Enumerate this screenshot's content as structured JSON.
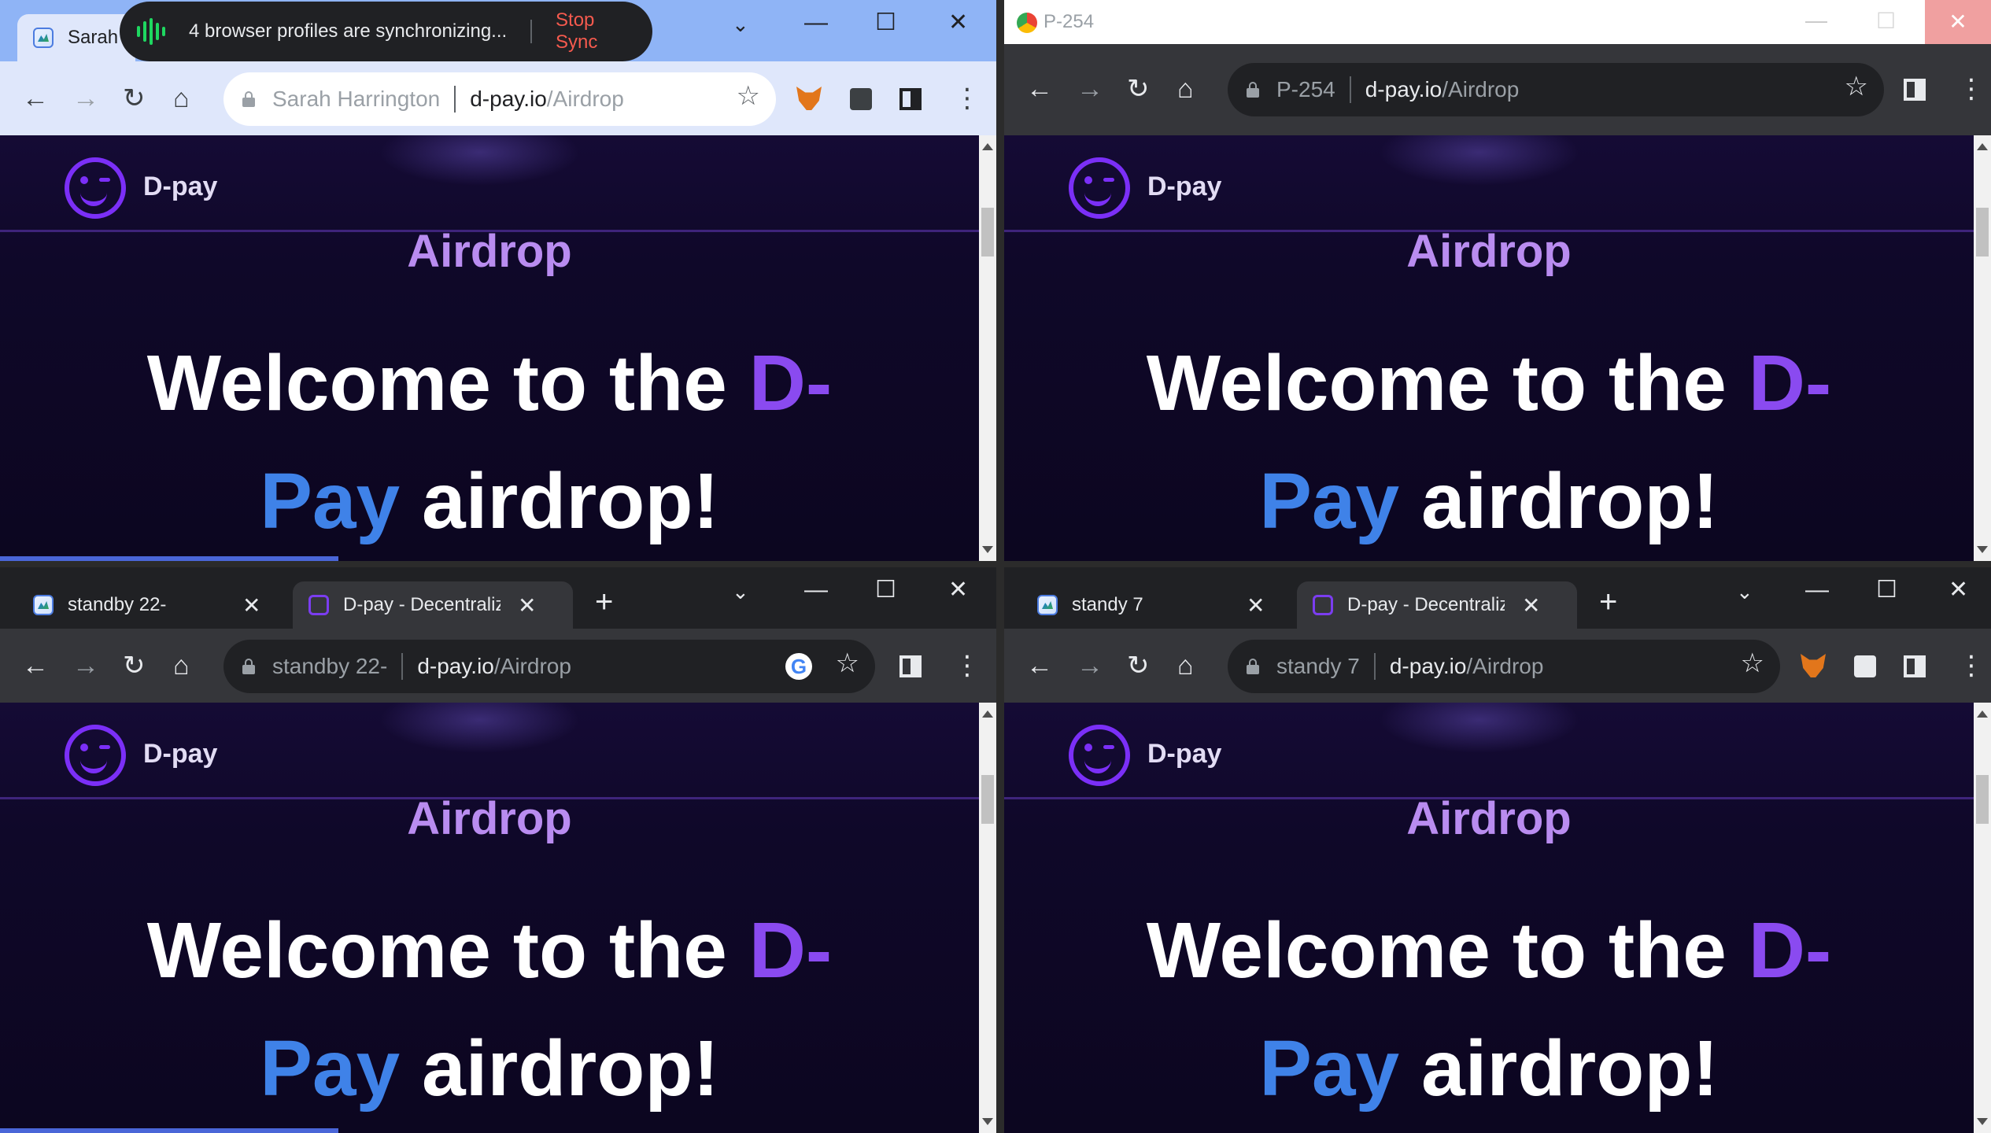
{
  "sync_notice": {
    "message": "4 browser profiles are synchronizing...",
    "stop_label": "Stop Sync"
  },
  "windows": [
    {
      "profile_tab": "Sarah",
      "omnibox": {
        "profile": "Sarah Harrington",
        "domain": "d-pay.io",
        "path": "/Airdrop"
      },
      "page": {
        "brand": "D-pay",
        "heading": "Airdrop",
        "welcome_a": "Welcome to the",
        "welcome_dp1": "D-",
        "welcome_dp2": "Pay",
        "welcome_b": "airdrop!"
      }
    },
    {
      "window_title": "P-254",
      "omnibox": {
        "profile": "P-254",
        "domain": "d-pay.io",
        "path": "/Airdrop"
      },
      "page": {
        "brand": "D-pay",
        "heading": "Airdrop",
        "welcome_a": "Welcome to the",
        "welcome_dp1": "D-",
        "welcome_dp2": "Pay",
        "welcome_b": "airdrop!"
      }
    },
    {
      "tabs": [
        {
          "title": "standby 22-"
        },
        {
          "title": "D-pay - Decentralize"
        }
      ],
      "omnibox": {
        "profile": "standby 22-",
        "domain": "d-pay.io",
        "path": "/Airdrop"
      },
      "page": {
        "brand": "D-pay",
        "heading": "Airdrop",
        "welcome_a": "Welcome to the",
        "welcome_dp1": "D-",
        "welcome_dp2": "Pay",
        "welcome_b": "airdrop!"
      }
    },
    {
      "tabs": [
        {
          "title": "standy 7"
        },
        {
          "title": "D-pay - Decentralize"
        }
      ],
      "omnibox": {
        "profile": "standy 7",
        "domain": "d-pay.io",
        "path": "/Airdrop"
      },
      "page": {
        "brand": "D-pay",
        "heading": "Airdrop",
        "welcome_a": "Welcome to the",
        "welcome_dp1": "D-",
        "welcome_dp2": "Pay",
        "welcome_b": "airdrop!"
      }
    }
  ],
  "icons": {
    "back": "←",
    "forward": "→",
    "reload": "↻",
    "home": "⌂",
    "star": "☆",
    "menu": "⋮",
    "close": "✕",
    "minimize": "—",
    "maximize": "☐",
    "caret": "⌄",
    "new_tab": "+",
    "google": "G"
  },
  "colors": {
    "accent_purple": "#8a4af0",
    "accent_blue": "#3f82e8",
    "stop_red": "#f55a4e",
    "sync_green": "#1ed760",
    "page_bg": "#0f0829"
  }
}
